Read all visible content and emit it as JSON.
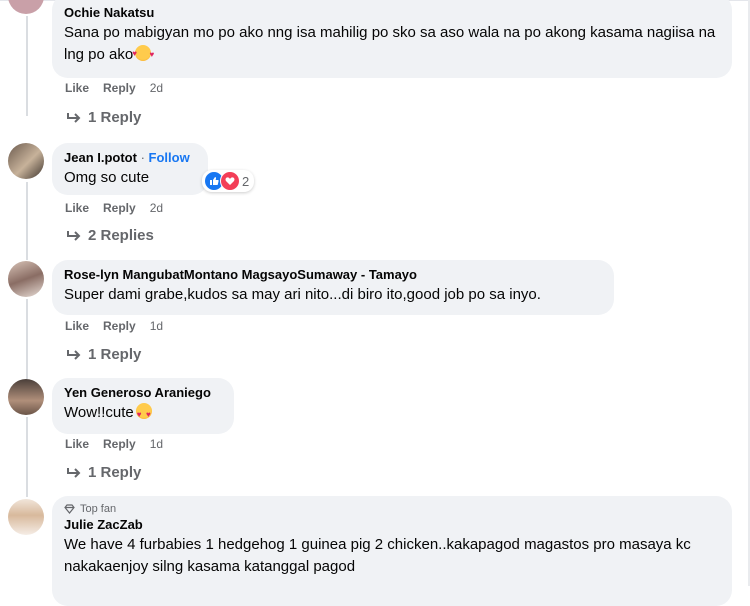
{
  "comments": [
    {
      "author": "Ochie Nakatsu",
      "text": "Sana po mabigyan mo po ako nng isa mahilig po sko sa aso wala na po akong kasama nagiisa na lng po ako",
      "like_label": "Like",
      "reply_label": "Reply",
      "time": "2d",
      "replies_label": "1 Reply",
      "emoji": "smiling-face-with-hearts"
    },
    {
      "author": "Jean I.potot",
      "follow_label": "Follow",
      "separator": "·",
      "text": "Omg so cute",
      "reaction_count": "2",
      "like_label": "Like",
      "reply_label": "Reply",
      "time": "2d",
      "replies_label": "2 Replies"
    },
    {
      "author": "Rose-lyn MangubatMontano MagsayoSumaway - Tamayo",
      "text": "Super dami grabe,kudos sa may ari nito...di biro ito,good job po sa inyo.",
      "like_label": "Like",
      "reply_label": "Reply",
      "time": "1d",
      "replies_label": "1 Reply"
    },
    {
      "author": "Yen Generoso Araniego",
      "text": "Wow!!cute",
      "like_label": "Like",
      "reply_label": "Reply",
      "time": "1d",
      "replies_label": "1 Reply",
      "emoji": "heart-eyes"
    },
    {
      "badge": "Top fan",
      "author": "Julie ZacZab",
      "text": "We have 4 furbabies 1 hedgehog 1 guinea pig 2 chicken..kakapagod magastos pro masaya kc nakakaenjoy silng kasama katanggal pagod"
    }
  ],
  "colors": {
    "bubble": "#f0f2f5",
    "secondary_text": "#65676b",
    "link": "#1877f2",
    "like_reaction": "#1877f2",
    "love_reaction": "#f33e58"
  }
}
